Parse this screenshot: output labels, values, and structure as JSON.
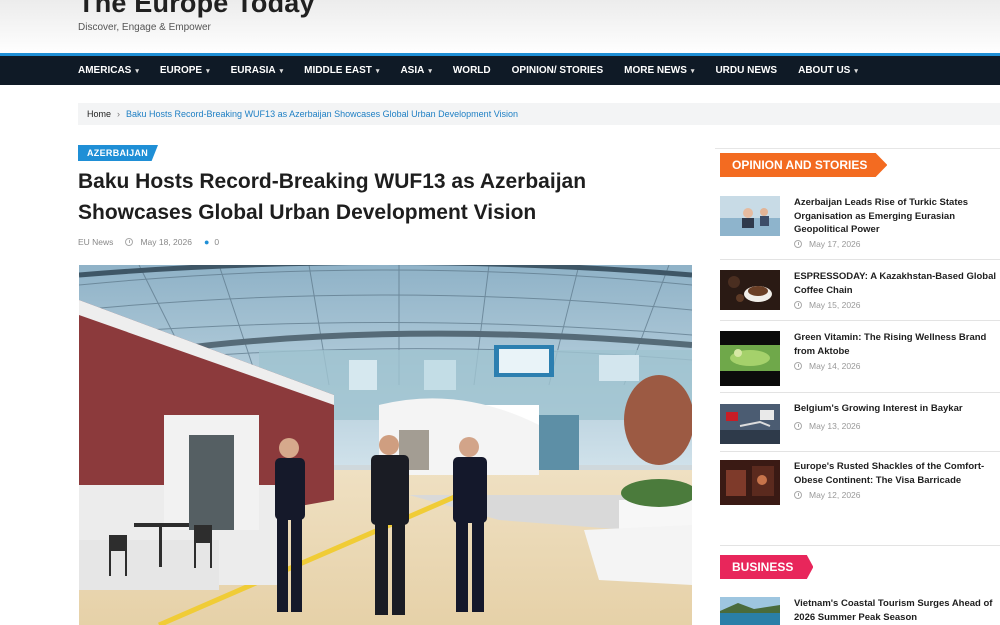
{
  "site": {
    "title": "The Europe Today",
    "tagline": "Discover, Engage & Empower"
  },
  "nav": [
    {
      "label": "AMERICAS",
      "caret": true
    },
    {
      "label": "EUROPE",
      "caret": true
    },
    {
      "label": "EURASIA",
      "caret": true
    },
    {
      "label": "MIDDLE EAST",
      "caret": true
    },
    {
      "label": "ASIA",
      "caret": true
    },
    {
      "label": "WORLD",
      "caret": false
    },
    {
      "label": "OPINION/ STORIES",
      "caret": false
    },
    {
      "label": "MORE NEWS",
      "caret": true
    },
    {
      "label": "URDU NEWS",
      "caret": false
    },
    {
      "label": "ABOUT US",
      "caret": true
    }
  ],
  "breadcrumb": {
    "home": "Home",
    "separator": "›",
    "current": "Baku Hosts Record-Breaking WUF13 as Azerbaijan Showcases Global Urban Development Vision"
  },
  "article": {
    "category": "AZERBAIJAN",
    "title": "Baku Hosts Record-Breaking WUF13 as Azerbaijan Showcases Global Urban Development Vision",
    "author": "EU News",
    "date": "May 18, 2026",
    "comments": "0"
  },
  "sidebar": {
    "opinion_label": "OPINION AND STORIES",
    "business_label": "BUSINESS",
    "opinion_items": [
      {
        "title": "Azerbaijan Leads Rise of Turkic States Organisation as Emerging Eurasian Geopolitical Power",
        "date": "May 17, 2026"
      },
      {
        "title": "ESPRESSODAY: A Kazakhstan-Based Global Coffee Chain",
        "date": "May 15, 2026"
      },
      {
        "title": "Green Vitamin: The Rising Wellness Brand from Aktobe",
        "date": "May 14, 2026"
      },
      {
        "title": "Belgium's Growing Interest in Baykar",
        "date": "May 13, 2026"
      },
      {
        "title": "Europe's Rusted Shackles of the Comfort-Obese Continent: The Visa Barricade",
        "date": "May 12, 2026"
      }
    ],
    "business_items": [
      {
        "title": "Vietnam's Coastal Tourism Surges Ahead of 2026 Summer Peak Season"
      }
    ]
  },
  "colors": {
    "accent_blue": "#1f8fd6",
    "nav_bg": "#0f1a26",
    "opinion_orange": "#f36b21",
    "business_pink": "#e8265b"
  }
}
